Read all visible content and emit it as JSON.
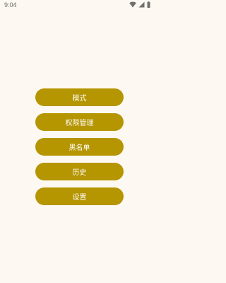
{
  "status_bar": {
    "time": "9:04",
    "icons": [
      "wifi-icon",
      "signal-icon",
      "battery-icon"
    ]
  },
  "menu": {
    "items": [
      {
        "label": "模式"
      },
      {
        "label": "权限管理"
      },
      {
        "label": "黑名单"
      },
      {
        "label": "历史"
      },
      {
        "label": "设置"
      }
    ]
  },
  "colors": {
    "background": "#fdf9f2",
    "button": "#b59500",
    "button_text": "#ffffff"
  }
}
